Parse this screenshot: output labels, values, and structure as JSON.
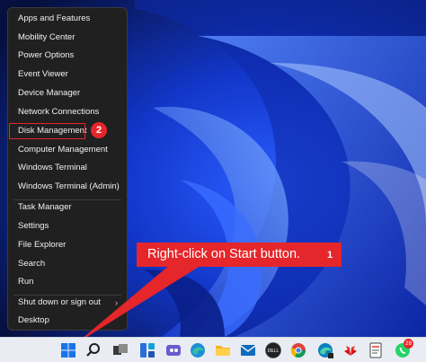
{
  "context_menu": {
    "items": [
      {
        "label": "Apps and Features"
      },
      {
        "label": "Mobility Center"
      },
      {
        "label": "Power Options"
      },
      {
        "label": "Event Viewer"
      },
      {
        "label": "Device Manager"
      },
      {
        "label": "Network Connections"
      },
      {
        "label": "Disk Management"
      },
      {
        "label": "Computer Management"
      },
      {
        "label": "Windows Terminal"
      },
      {
        "label": "Windows Terminal (Admin)"
      },
      {
        "label": "Task Manager"
      },
      {
        "label": "Settings"
      },
      {
        "label": "File Explorer"
      },
      {
        "label": "Search"
      },
      {
        "label": "Run"
      },
      {
        "label": "Shut down or sign out"
      },
      {
        "label": "Desktop"
      }
    ],
    "submenu_chevron": "›"
  },
  "annotations": {
    "step2_badge": "2",
    "callout_text": "Right-click on Start button.",
    "step1_badge": "1",
    "accent_color": "#e5262a"
  },
  "taskbar": {
    "icons": [
      "windows-start-icon",
      "search-icon",
      "task-view-icon",
      "widgets-icon",
      "teams-chat-icon",
      "edge-icon",
      "file-explorer-icon",
      "mail-icon",
      "dell-icon",
      "chrome-icon",
      "edge-dev-icon",
      "huawei-icon",
      "notepad-icon",
      "whatsapp-icon"
    ],
    "dell_label": "DELL",
    "notification_count": "28"
  }
}
